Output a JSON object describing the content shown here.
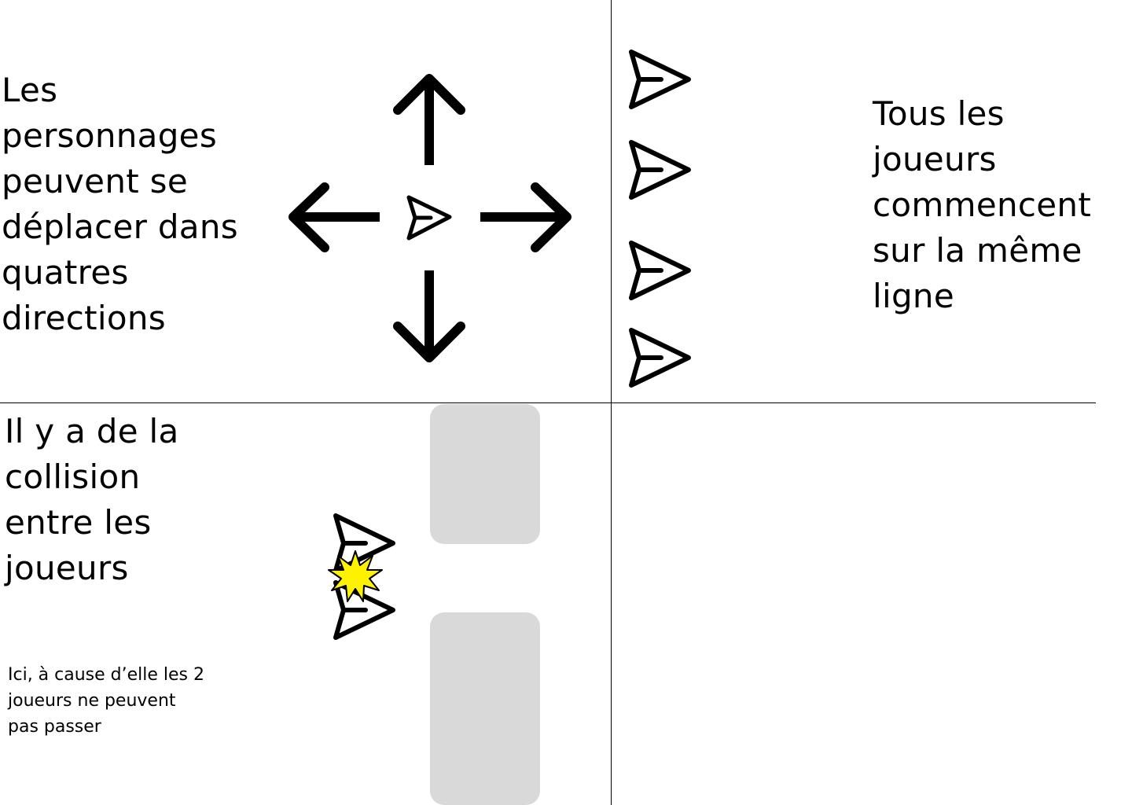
{
  "panels": {
    "movement": {
      "text": "Les\npersonnages\npeuvent se\ndéplacer dans\nquatres\ndirections",
      "directions": [
        "up",
        "down",
        "left",
        "right"
      ],
      "icons": [
        "arrow-up-icon",
        "arrow-down-icon",
        "arrow-left-icon",
        "arrow-right-icon",
        "player-arrow-icon"
      ]
    },
    "start_line": {
      "text": "Tous les\njoueurs\ncommencent\nsur la même\nligne",
      "player_count": 4,
      "icon": "player-arrow-icon"
    },
    "collision": {
      "text": "Il y a de la\ncollision\nentre les\njoueurs",
      "note": "Ici, à cause d’elle les 2\njoueurs ne peuvent\npas passer",
      "player_count": 2,
      "icons": [
        "player-arrow-icon",
        "collision-burst-icon"
      ]
    }
  },
  "colors": {
    "line": "#000000",
    "wall": "#d9d9d9",
    "burst": "#fff200",
    "background": "#ffffff"
  }
}
